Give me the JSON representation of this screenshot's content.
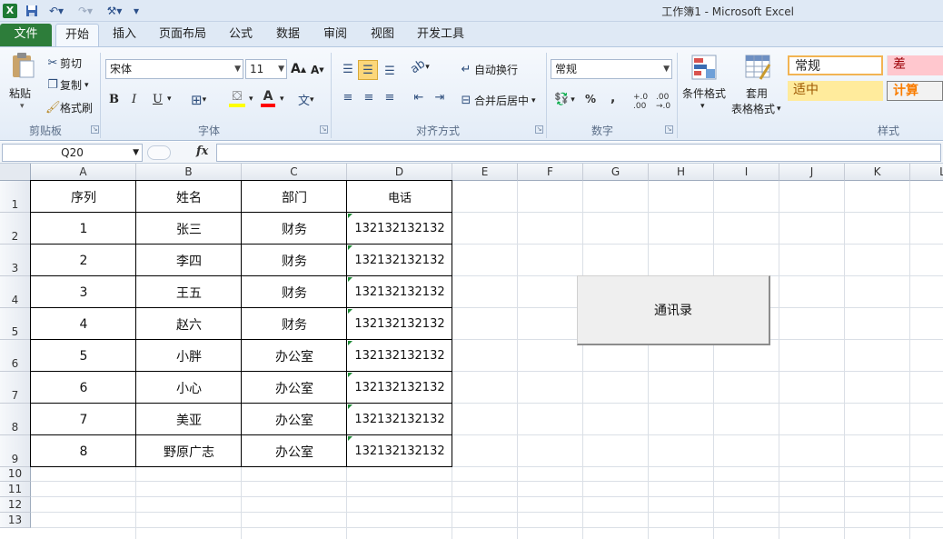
{
  "window": {
    "title": "工作簿1 - Microsoft Excel"
  },
  "tabs": [
    "文件",
    "开始",
    "插入",
    "页面布局",
    "公式",
    "数据",
    "审阅",
    "视图",
    "开发工具"
  ],
  "clipboard": {
    "paste": "粘贴",
    "cut": "剪切",
    "copy": "复制",
    "format_painter": "格式刷",
    "group": "剪贴板"
  },
  "font": {
    "name": "宋体",
    "size": "11",
    "bold": "B",
    "italic": "I",
    "underline": "U",
    "group": "字体"
  },
  "alignment": {
    "wrap": "自动换行",
    "merge": "合并后居中",
    "group": "对齐方式"
  },
  "number": {
    "format": "常规",
    "percent": "%",
    "comma": ",",
    "group": "数字"
  },
  "styles": {
    "conditional": "条件格式",
    "table_format_1": "套用",
    "table_format_2": "表格格式",
    "normal": "常规",
    "bad": "差",
    "neutral": "适中",
    "calc": "计算",
    "group": "样式"
  },
  "formula_bar": {
    "name_box": "Q20",
    "fx": "fx"
  },
  "columns": [
    "A",
    "B",
    "C",
    "D",
    "E",
    "F",
    "G",
    "H",
    "I",
    "J",
    "K",
    "L"
  ],
  "rows": [
    "1",
    "2",
    "3",
    "4",
    "5",
    "6",
    "7",
    "8",
    "9",
    "10",
    "11",
    "12",
    "13"
  ],
  "table": {
    "headers": [
      "序列",
      "姓名",
      "部门",
      "电话"
    ],
    "rows": [
      [
        "1",
        "张三",
        "财务",
        "132132132132"
      ],
      [
        "2",
        "李四",
        "财务",
        "132132132132"
      ],
      [
        "3",
        "王五",
        "财务",
        "132132132132"
      ],
      [
        "4",
        "赵六",
        "财务",
        "132132132132"
      ],
      [
        "5",
        "小胖",
        "办公室",
        "132132132132"
      ],
      [
        "6",
        "小心",
        "办公室",
        "132132132132"
      ],
      [
        "7",
        "美亚",
        "办公室",
        "132132132132"
      ],
      [
        "8",
        "野原广志",
        "办公室",
        "132132132132"
      ]
    ]
  },
  "button": {
    "label": "通讯录"
  }
}
